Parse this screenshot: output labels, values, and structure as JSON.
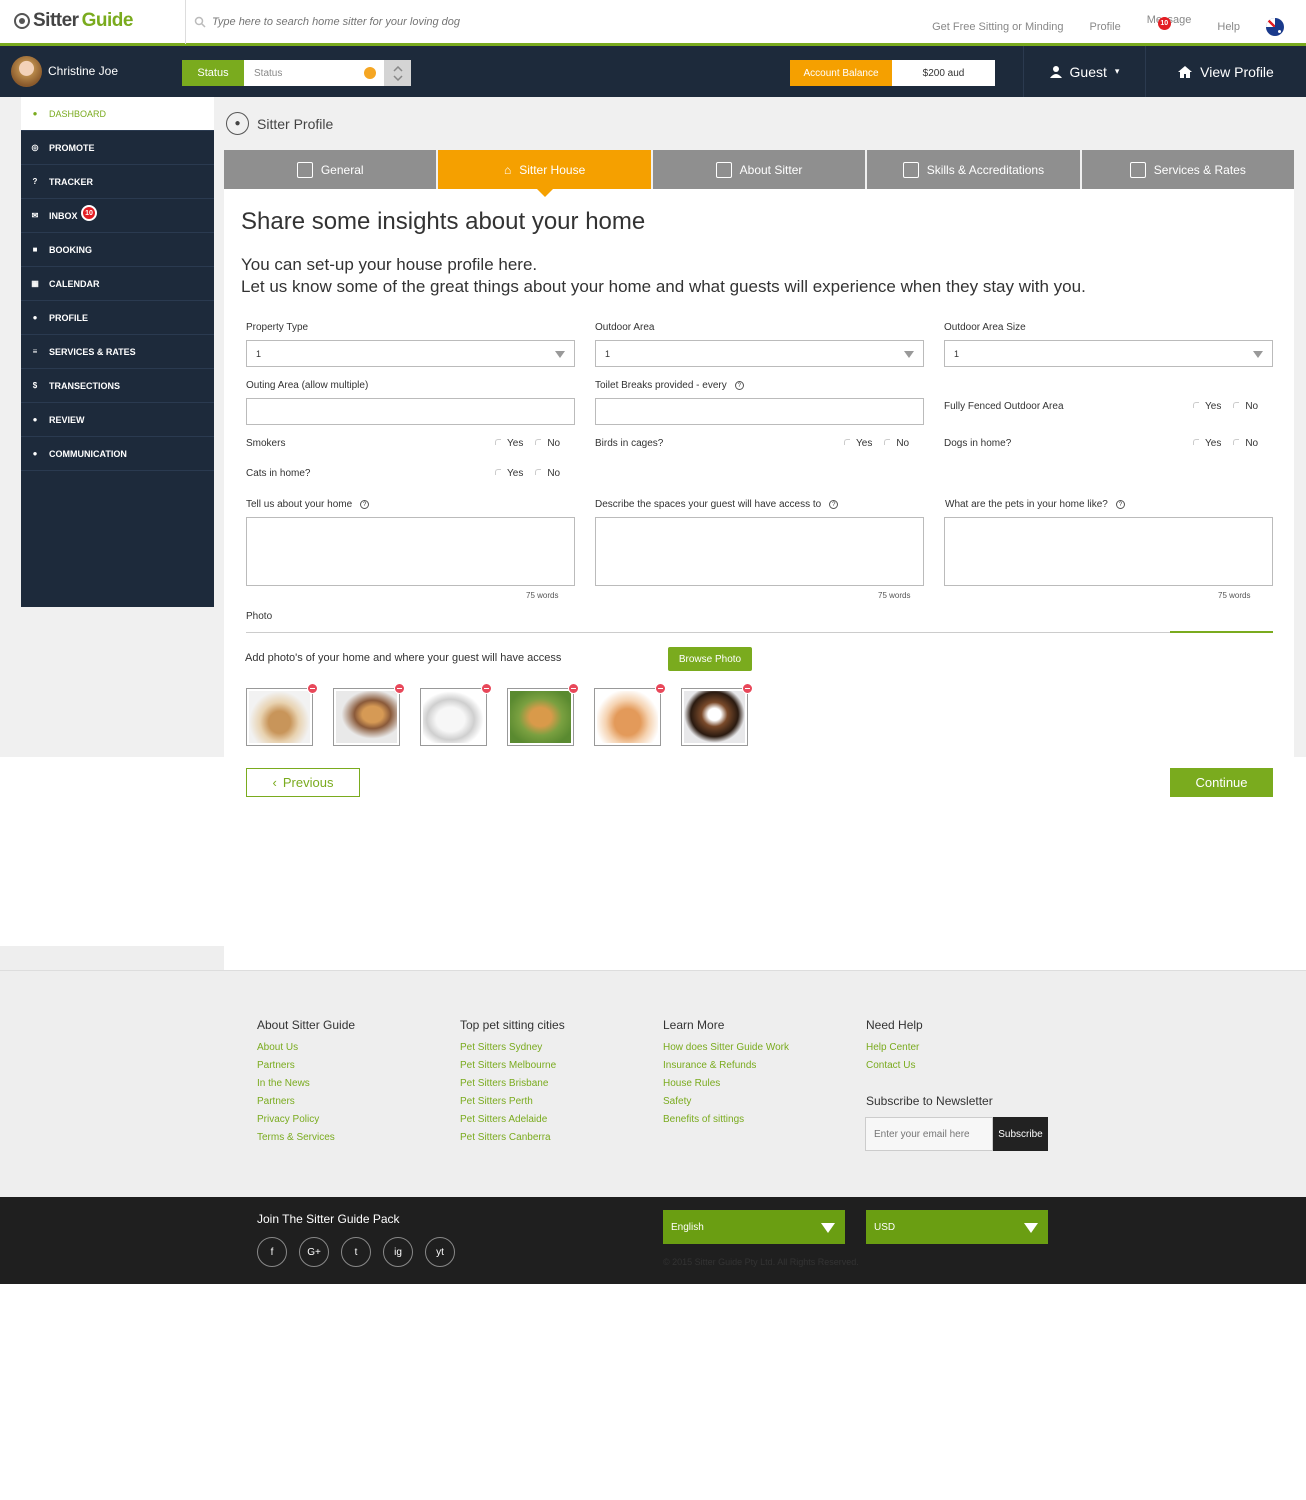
{
  "header": {
    "logo_a": "Sitter",
    "logo_b": "Guide",
    "search_placeholder": "Type here to search home sitter for your loving dog",
    "links": [
      "Get Free Sitting or Minding",
      "Profile",
      "Message",
      "Help"
    ],
    "message_badge": "10"
  },
  "navbar": {
    "user_name": "Christine Joe",
    "status_label": "Status",
    "status_value": "Status",
    "account_label": "Account Balance",
    "account_value": "$200 aud",
    "guest": "Guest",
    "view_profile": "View Profile"
  },
  "sidebar": {
    "items": [
      {
        "label": "DASHBOARD",
        "icon": "user-icon"
      },
      {
        "label": "PROMOTE",
        "icon": "target-icon"
      },
      {
        "label": "TRACKER",
        "icon": "question-icon"
      },
      {
        "label": "INBOX",
        "icon": "envelope-icon",
        "badge": "10"
      },
      {
        "label": "BOOKING",
        "icon": "briefcase-icon"
      },
      {
        "label": "CALENDAR",
        "icon": "calendar-icon"
      },
      {
        "label": "PROFILE",
        "icon": "user-icon"
      },
      {
        "label": "SERVICES & RATES",
        "icon": "list-icon"
      },
      {
        "label": "TRANSECTIONS",
        "icon": "dollar-icon"
      },
      {
        "label": "REVIEW",
        "icon": "comment-icon"
      },
      {
        "label": "COMMUNICATION",
        "icon": "users-icon"
      }
    ]
  },
  "page": {
    "title": "Sitter Profile",
    "tabs": [
      "General",
      "Sitter House",
      "About Sitter",
      "Skills & Accreditations",
      "Services & Rates"
    ],
    "heading": "Share some insights about your home",
    "intro1": "You can set-up your house profile here.",
    "intro2": "Let us know some of the great things about your home and what guests will experience when they stay with you."
  },
  "form": {
    "property_type_label": "Property Type",
    "property_type_value": "1",
    "outdoor_area_label": "Outdoor Area",
    "outdoor_area_value": "1",
    "outdoor_size_label": "Outdoor Area Size",
    "outdoor_size_value": "1",
    "outing_label": "Outing Area (allow multiple)",
    "toilet_label": "Toilet Breaks provided - every",
    "fenced_label": "Fully Fenced Outdoor Area",
    "smokers_label": "Smokers",
    "birds_label": "Birds in cages?",
    "dogs_label": "Dogs in home?",
    "cats_label": "Cats in home?",
    "yes": "Yes",
    "no": "No",
    "home_label": "Tell us about your home",
    "spaces_label": "Describe the spaces your guest will have access to",
    "pets_label": "What are the pets in your home like?",
    "words": "75 words",
    "photo_label": "Photo",
    "photo_instr": "Add photo's of your home and where your guest will have access",
    "browse": "Browse Photo",
    "previous": "Previous",
    "continue": "Continue"
  },
  "footer": {
    "col1_title": "About Sitter Guide",
    "col1": [
      "About Us",
      "Partners",
      "In the News",
      "Partners",
      "Privacy Policy",
      "Terms & Services"
    ],
    "col2_title": "Top pet sitting cities",
    "col2": [
      "Pet Sitters Sydney",
      "Pet Sitters Melbourne",
      "Pet Sitters Brisbane",
      "Pet Sitters Perth",
      "Pet Sitters Adelaide",
      "Pet Sitters Canberra"
    ],
    "col3_title": "Learn More",
    "col3": [
      "How does Sitter Guide Work",
      "Insurance & Refunds",
      "House Rules",
      "Safety",
      "Benefits of sittings"
    ],
    "col4_title": "Need Help",
    "col4": [
      "Help Center",
      "Contact Us"
    ],
    "newsletter_title": "Subscribe to Newsletter",
    "newsletter_placeholder": "Enter your email here",
    "subscribe": "Subscribe",
    "join": "Join The Sitter Guide Pack",
    "socials": [
      "f",
      "G+",
      "t",
      "ig",
      "yt"
    ],
    "language": "English",
    "currency": "USD",
    "copyright": "© 2015 Sitter Guide Pty Ltd. All Rights Reserved."
  }
}
